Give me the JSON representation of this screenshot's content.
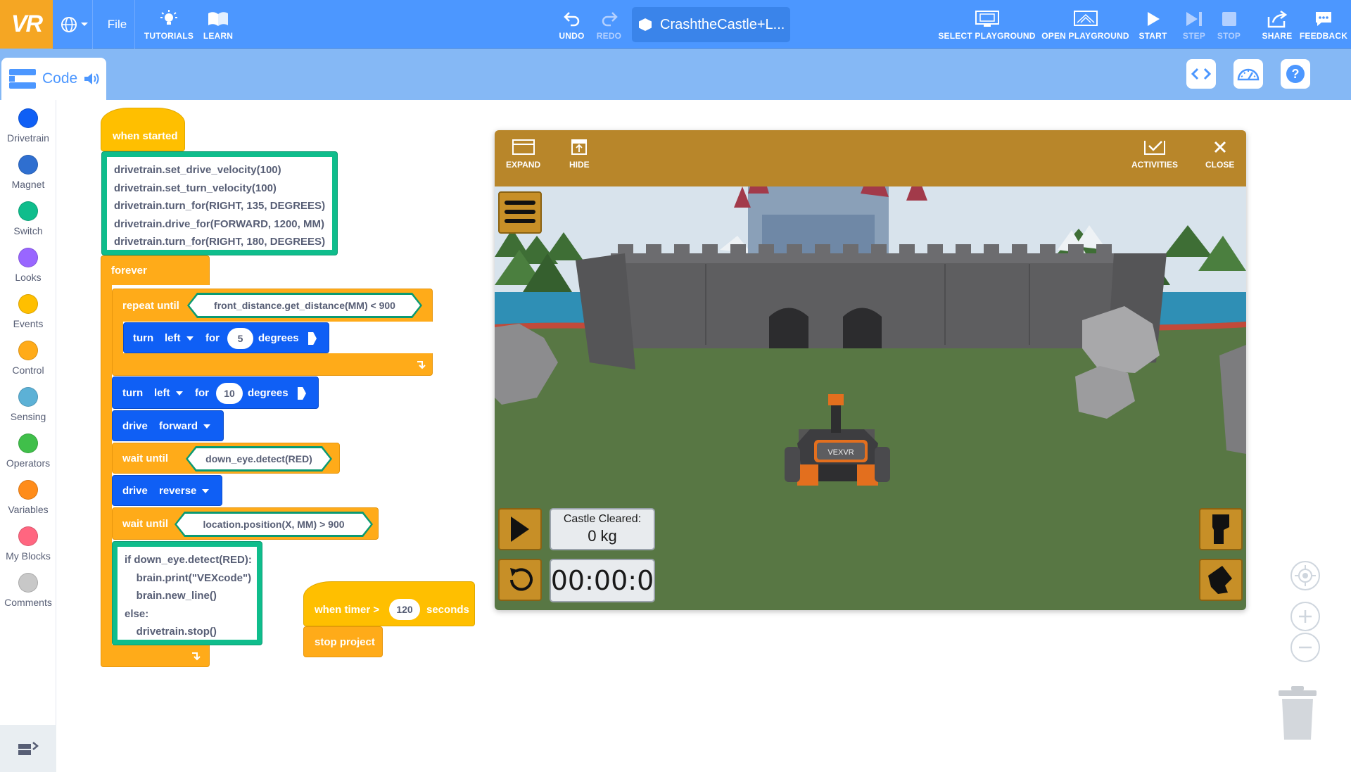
{
  "app": {
    "logo_text": "VR",
    "file_menu": "File",
    "project_title": "CrashtheCastle+L..."
  },
  "toolbar": {
    "tutorials": "TUTORIALS",
    "learn": "LEARN",
    "undo": "UNDO",
    "redo": "REDO",
    "select_playground": "SELECT PLAYGROUND",
    "open_playground": "OPEN PLAYGROUND",
    "start": "START",
    "step": "STEP",
    "stop": "STOP",
    "share": "SHARE",
    "feedback": "FEEDBACK"
  },
  "code_tab": {
    "label": "Code"
  },
  "categories": [
    {
      "label": "Drivetrain",
      "color": "#0f5ff5"
    },
    {
      "label": "Magnet",
      "color": "#2f6fd0"
    },
    {
      "label": "Switch",
      "color": "#0fbd8c"
    },
    {
      "label": "Looks",
      "color": "#9966ff"
    },
    {
      "label": "Events",
      "color": "#ffbf00"
    },
    {
      "label": "Control",
      "color": "#ffab19"
    },
    {
      "label": "Sensing",
      "color": "#5cb1d6"
    },
    {
      "label": "Operators",
      "color": "#40bf4a"
    },
    {
      "label": "Variables",
      "color": "#ff8c1a"
    },
    {
      "label": "My Blocks",
      "color": "#ff6680"
    },
    {
      "label": "Comments",
      "color": "#c8c8c8"
    }
  ],
  "blocks": {
    "when_started": "when started",
    "python_lines": "drivetrain.set_drive_velocity(100)\ndrivetrain.set_turn_velocity(100)\ndrivetrain.turn_for(RIGHT, 135, DEGREES)\ndrivetrain.drive_for(FORWARD, 1200, MM)\ndrivetrain.turn_for(RIGHT, 180, DEGREES)",
    "forever": "forever",
    "repeat_until": "repeat until",
    "repeat_condition": "front_distance.get_distance(MM) < 900",
    "turn1": {
      "verb": "turn",
      "dir": "left",
      "for": "for",
      "value": "5",
      "unit": "degrees"
    },
    "turn2": {
      "verb": "turn",
      "dir": "left",
      "for": "for",
      "value": "10",
      "unit": "degrees"
    },
    "drive1": {
      "verb": "drive",
      "dir": "forward"
    },
    "wait1": {
      "label": "wait until",
      "condition": "down_eye.detect(RED)"
    },
    "drive2": {
      "verb": "drive",
      "dir": "reverse"
    },
    "wait2": {
      "label": "wait until",
      "condition": "location.position(X, MM) > 900"
    },
    "python_if": "if down_eye.detect(RED):\n    brain.print(\"VEXcode\")\n    brain.new_line()\nelse:\n    drivetrain.stop()",
    "when_timer": "when timer >",
    "timer_value": "120",
    "seconds": "seconds",
    "stop_project": "stop project"
  },
  "playground": {
    "expand": "EXPAND",
    "hide": "HIDE",
    "activities": "ACTIVITIES",
    "close": "CLOSE",
    "castle_label": "Castle Cleared:",
    "castle_value": "0 kg",
    "timer": "00:00:0",
    "robot_label": "VEXVR"
  },
  "colors": {
    "menu_bar": "#4c97ff",
    "sub_bar": "#85b8f5",
    "events": "#ffbf00",
    "control": "#ffab19",
    "drivetrain": "#0f5ff5",
    "switch": "#0fbd8c",
    "playground_header": "#b8862a"
  }
}
